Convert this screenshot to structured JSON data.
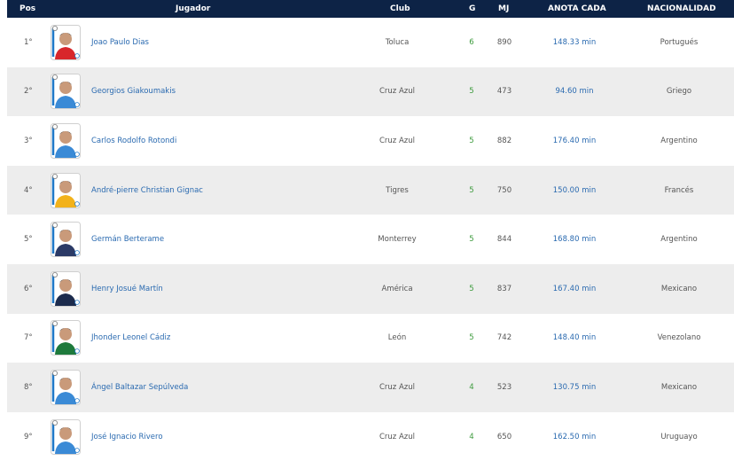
{
  "header": {
    "pos": "Pos",
    "player": "Jugador",
    "club": "Club",
    "goals": "G",
    "mj": "MJ",
    "rate": "ANOTA CADA",
    "nationality": "NACIONALIDAD"
  },
  "colors": {
    "header_bg": "#0d2346",
    "row_alt": "#ededed",
    "link": "#2a6ab0",
    "goals": "#3c9a3c"
  },
  "rows": [
    {
      "pos": "1°",
      "name": "Joao Paulo Dias",
      "club": "Toluca",
      "goals": "6",
      "mj": "890",
      "rate": "148.33 min",
      "nat": "Portugués",
      "kit": "#d8262b"
    },
    {
      "pos": "2°",
      "name": "Georgios Giakoumakis",
      "club": "Cruz Azul",
      "goals": "5",
      "mj": "473",
      "rate": "94.60 min",
      "nat": "Griego",
      "kit": "#3a8ad6"
    },
    {
      "pos": "3°",
      "name": "Carlos Rodolfo Rotondi",
      "club": "Cruz Azul",
      "goals": "5",
      "mj": "882",
      "rate": "176.40 min",
      "nat": "Argentino",
      "kit": "#3a8ad6"
    },
    {
      "pos": "4°",
      "name": "André-pierre Christian Gignac",
      "club": "Tigres",
      "goals": "5",
      "mj": "750",
      "rate": "150.00 min",
      "nat": "Francés",
      "kit": "#f2b21b"
    },
    {
      "pos": "5°",
      "name": "Germán Berterame",
      "club": "Monterrey",
      "goals": "5",
      "mj": "844",
      "rate": "168.80 min",
      "nat": "Argentino",
      "kit": "#2b3a66"
    },
    {
      "pos": "6°",
      "name": "Henry Josué Martín",
      "club": "América",
      "goals": "5",
      "mj": "837",
      "rate": "167.40 min",
      "nat": "Mexicano",
      "kit": "#1c2b4d"
    },
    {
      "pos": "7°",
      "name": "Jhonder Leonel Cádiz",
      "club": "León",
      "goals": "5",
      "mj": "742",
      "rate": "148.40 min",
      "nat": "Venezolano",
      "kit": "#1e7a3c"
    },
    {
      "pos": "8°",
      "name": "Ángel Baltazar Sepúlveda",
      "club": "Cruz Azul",
      "goals": "4",
      "mj": "523",
      "rate": "130.75 min",
      "nat": "Mexicano",
      "kit": "#3a8ad6"
    },
    {
      "pos": "9°",
      "name": "José Ignacio Rivero",
      "club": "Cruz Azul",
      "goals": "4",
      "mj": "650",
      "rate": "162.50 min",
      "nat": "Uruguayo",
      "kit": "#3a8ad6"
    }
  ]
}
